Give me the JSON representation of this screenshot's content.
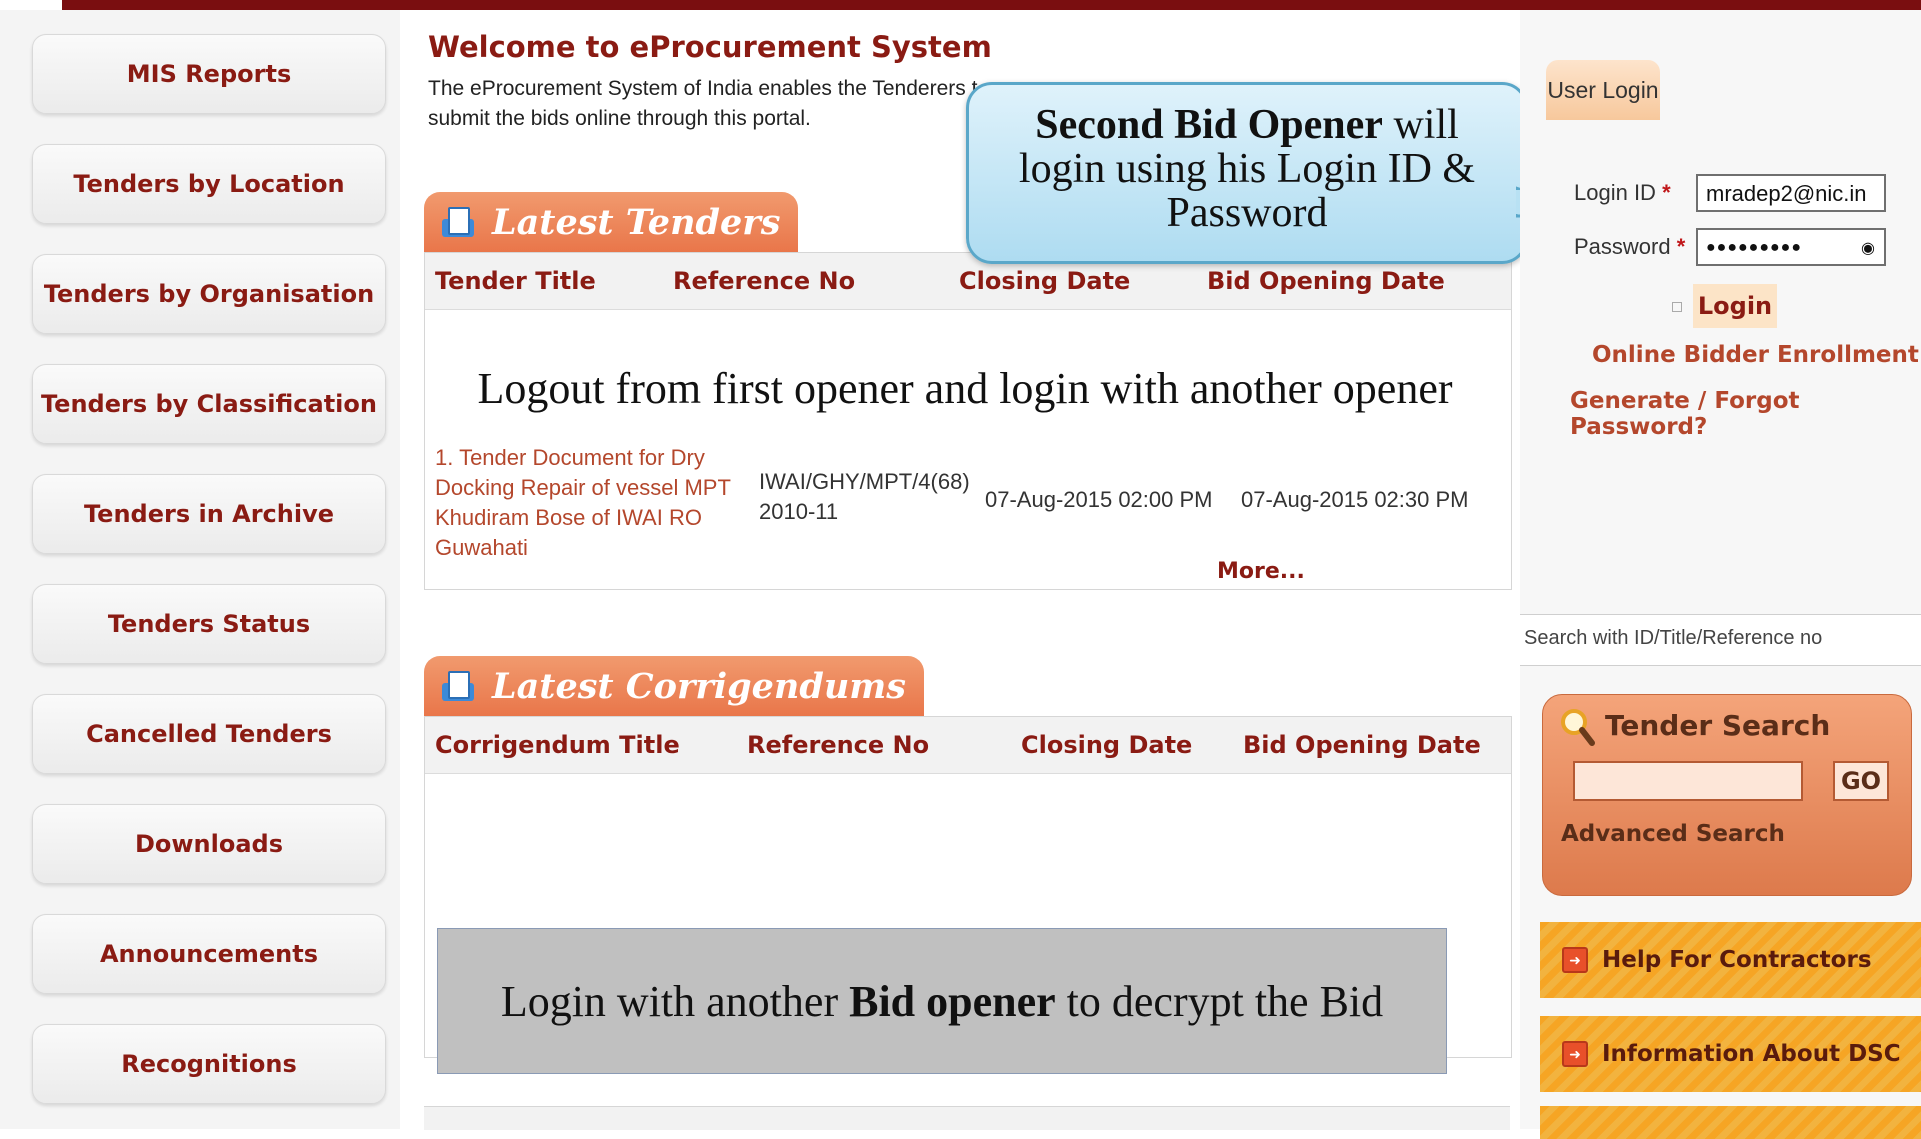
{
  "left_nav": {
    "items": [
      {
        "label": "MIS Reports"
      },
      {
        "label": "Tenders by Location"
      },
      {
        "label": "Tenders by Organisation"
      },
      {
        "label": "Tenders by Classification"
      },
      {
        "label": "Tenders in Archive"
      },
      {
        "label": "Tenders Status"
      },
      {
        "label": "Cancelled Tenders"
      },
      {
        "label": "Downloads"
      },
      {
        "label": "Announcements"
      },
      {
        "label": "Recognitions"
      }
    ]
  },
  "welcome": {
    "title": "Welcome to eProcurement System",
    "text_visible_start": "The eProcurement System of India enables the Tenderers t",
    "text_visible_end": "submit the bids online through this portal."
  },
  "latest_tenders": {
    "tab_label": "Latest Tenders",
    "columns": [
      "Tender Title",
      "Reference No",
      "Closing Date",
      "Bid Opening Date"
    ],
    "rows": [
      {
        "title": "1. Tender Document for Dry Docking Repair of vessel MPT Khudiram Bose of IWAI RO Guwahati",
        "reference": "IWAI/GHY/MPT/4(68) 2010-11",
        "closing": "07-Aug-2015 02:00 PM",
        "opening": "07-Aug-2015 02:30 PM"
      }
    ],
    "more": "More..."
  },
  "latest_corrigendums": {
    "tab_label": "Latest Corrigendums",
    "columns": [
      "Corrigendum Title",
      "Reference No",
      "Closing Date",
      "Bid Opening Date"
    ]
  },
  "annotations": {
    "logout_text": "Logout from first opener and login with another opener",
    "callout_bold": "Second Bid Opener",
    "callout_rest_1": " will",
    "callout_line_2": "login using his Login ID &",
    "callout_line_3": "Password",
    "grey_box_pre": "Login with another ",
    "grey_box_bold": "Bid opener",
    "grey_box_post": " to decrypt the Bid"
  },
  "user_login": {
    "tab_label": "User Login",
    "login_id_label": "Login ID",
    "login_id_value": "mradep2@nic.in",
    "password_label": "Password",
    "password_value": "●●●●●●●●●",
    "required_mark": "*",
    "login_button": "Login",
    "enroll_link": "Online Bidder Enrollment",
    "forgot_link": "Generate / Forgot Password?"
  },
  "search": {
    "hint": "Search with ID/Title/Reference no",
    "box_title": "Tender Search",
    "go_button": "GO",
    "advanced": "Advanced Search"
  },
  "help_links": [
    {
      "label": "Help For Contractors"
    },
    {
      "label": "Information About DSC"
    }
  ],
  "colors": {
    "brand_dark_red": "#7a0e10",
    "link_red": "#8a1b13",
    "tab_orange": "#e9764a",
    "help_orange": "#f6a524",
    "callout_blue": "#aedcf1"
  }
}
